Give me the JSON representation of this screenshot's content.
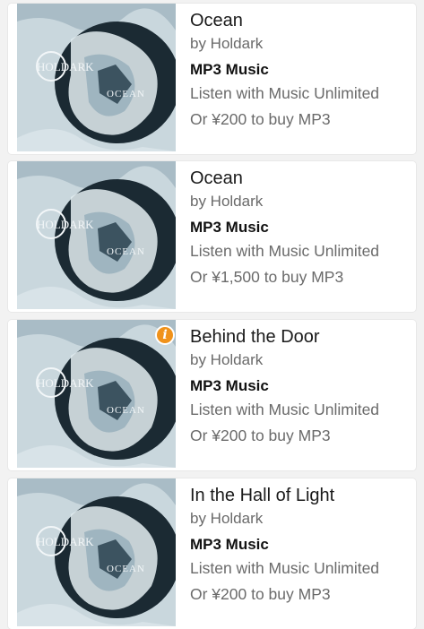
{
  "cover_art": {
    "logo_text": "HOLDARK",
    "album_text": "OCEAN"
  },
  "items": [
    {
      "title": "Ocean",
      "artist": "by Holdark",
      "format": "MP3 Music",
      "unlimited": "Listen with Music Unlimited",
      "price": "Or ¥200 to buy MP3",
      "info_badge": false
    },
    {
      "title": "Ocean",
      "artist": "by Holdark",
      "format": "MP3 Music",
      "unlimited": "Listen with Music Unlimited",
      "price": "Or ¥1,500 to buy MP3",
      "info_badge": false
    },
    {
      "title": "Behind the Door",
      "artist": "by Holdark",
      "format": "MP3 Music",
      "unlimited": "Listen with Music Unlimited",
      "price": "Or ¥200 to buy MP3",
      "info_badge": true,
      "info_badge_symbol": "i"
    },
    {
      "title": "In the Hall of Light",
      "artist": "by Holdark",
      "format": "MP3 Music",
      "unlimited": "Listen with Music Unlimited",
      "price": "Or ¥200 to buy MP3",
      "info_badge": false
    }
  ]
}
